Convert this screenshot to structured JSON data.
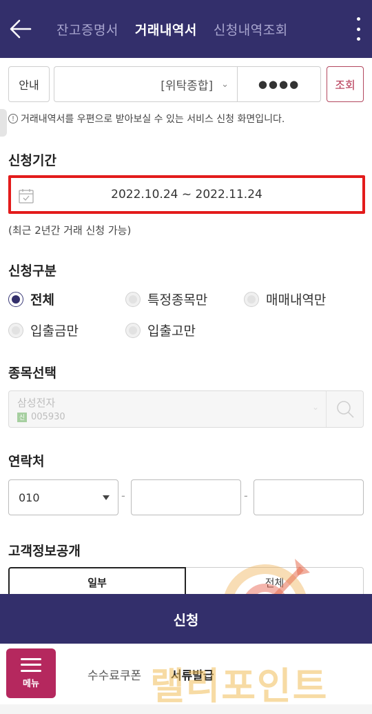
{
  "header": {
    "tabs": [
      {
        "label": "잔고증명서",
        "active": false
      },
      {
        "label": "거래내역서",
        "active": true
      },
      {
        "label": "신청내역조회",
        "active": false
      }
    ]
  },
  "account": {
    "guide_label": "안내",
    "account_type": "[위탁종합]",
    "password_mask": "●●●●",
    "query_label": "조회"
  },
  "notice": "거래내역서를 우편으로 받아보실 수 있는 서비스 신청 화면입니다.",
  "period": {
    "title": "신청기간",
    "value": "2022.10.24 ~ 2022.11.24",
    "hint": "(최근 2년간 거래 신청 가능)"
  },
  "category": {
    "title": "신청구분",
    "options": [
      {
        "label": "전체",
        "checked": true
      },
      {
        "label": "특정종목만",
        "checked": false
      },
      {
        "label": "매매내역만",
        "checked": false
      },
      {
        "label": "입출금만",
        "checked": false
      },
      {
        "label": "입출고만",
        "checked": false
      }
    ]
  },
  "stock": {
    "title": "종목선택",
    "name": "삼성전자",
    "badge": "신",
    "code": "005930"
  },
  "contact": {
    "title": "연락처",
    "prefix": "010",
    "separator": "-"
  },
  "disclosure": {
    "title": "고객정보공개",
    "options": [
      "일부",
      "전체"
    ],
    "selected": "일부"
  },
  "submit_label": "신청",
  "bottom_nav": {
    "menu_label": "메뉴",
    "items": [
      "수수료쿠폰",
      "서류발급"
    ]
  },
  "watermark_text": "랠리포인트",
  "colors": {
    "header_bg": "#332f6b",
    "highlight_border": "#e31b1b",
    "menu_bg": "#b5285e",
    "query_accent": "#b3304e"
  }
}
